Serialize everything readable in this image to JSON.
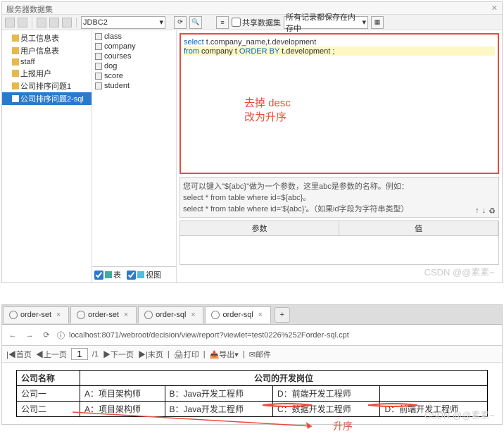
{
  "window_title": "服务器数据集",
  "toolbar": {
    "jdbc": "JDBC2",
    "share_label": "共享数据集",
    "records_label": "所有记录都保存在内存中"
  },
  "left_tree": [
    {
      "label": "员工信息表",
      "sel": false
    },
    {
      "label": "用户信息表",
      "sel": false
    },
    {
      "label": "staff",
      "sel": false
    },
    {
      "label": "上报用户",
      "sel": false
    },
    {
      "label": "公司排序问题1",
      "sel": false
    },
    {
      "label": "公司排序问题2-sql",
      "sel": true
    }
  ],
  "mid_list": [
    "class",
    "company",
    "courses",
    "dog",
    "score",
    "student"
  ],
  "mid_foot": {
    "table": "表",
    "view": "视图"
  },
  "sql": {
    "line1_a": "select",
    "line1_b": " t.company_name,t.development",
    "line2_a": "from",
    "line2_b": " company t ",
    "line2_c": "ORDER BY",
    "line2_d": " t.development ;"
  },
  "anno": {
    "l1": "去掉 desc",
    "l2": "改为升序"
  },
  "hint": {
    "l1": "您可以键入\"${abc}\"做为一个参数，这里abc是参数的名称。例如：",
    "l2": "select * from table where id=${abc}。",
    "l3": "select * from table where id='${abc}'。（如果id字段为字符串类型）"
  },
  "param": {
    "h1": "参数",
    "h2": "值"
  },
  "watermark": "CSDN @@素素~",
  "tabs": [
    {
      "label": "order-set",
      "active": false
    },
    {
      "label": "order-set",
      "active": false
    },
    {
      "label": "order-sql",
      "active": false
    },
    {
      "label": "order-sql",
      "active": true
    }
  ],
  "url": "localhost:8071/webroot/decision/view/report?viewlet=test0226%252Forder-sql.cpt",
  "rpt_tb": {
    "first": "|◀首页",
    "prev": "◀上一页",
    "page": "1",
    "total": "/1",
    "next": "▶下一页",
    "last": "▶|末页",
    "print": "打印",
    "export": "导出",
    "mail": "邮件"
  },
  "report": {
    "h1": "公司名称",
    "h2": "公司的开发岗位",
    "rows": [
      {
        "name": "公司一",
        "a": "A：项目架构师",
        "b": "B：Java开发工程师",
        "c": "D：前端开发工程师",
        "d": ""
      },
      {
        "name": "公司二",
        "a": "A：项目架构师",
        "b": "B：Java开发工程师",
        "c": "C：数据开发工程师",
        "d": "D：前端开发工程师"
      }
    ]
  },
  "arrow_label": "升序",
  "chart_data": null
}
